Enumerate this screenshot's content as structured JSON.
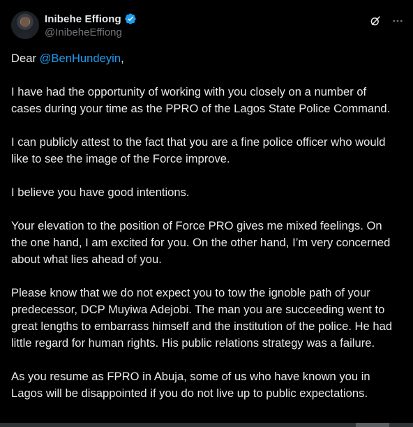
{
  "author": {
    "display_name": "Inibehe Effiong",
    "handle": "@InibeheEffiong",
    "verified_icon": "verified-badge-icon",
    "accent_color": "#1d9bf0"
  },
  "actions": {
    "grok_icon": "grok-icon",
    "more_icon": "more-icon"
  },
  "post": {
    "greeting_prefix": "Dear ",
    "greeting_mention": "@BenHundeyin",
    "greeting_suffix": ",",
    "paragraphs": [
      "I have had the opportunity of working with you closely on a number of cases during your time as the PPRO of the Lagos State Police Command.",
      "I can publicly attest to the fact that you are a fine police officer who would like to see the image of the Force improve.",
      "I believe you have good intentions.",
      "Your elevation to the position of Force PRO gives me mixed feelings. On the one hand, I am excited for you. On the other hand, I’m very concerned about what lies ahead of you.",
      "Please know that we do not expect you to tow the ignoble path of your predecessor, DCP Muyiwa Adejobi. The man you are succeeding went to great lengths to embarrass himself and the institution of the police. He had little regard for human rights. His public relations strategy was a failure.",
      "As you resume as FPRO in Abuja, some of us who have known you in Lagos will be disappointed if you do not live up to public expectations."
    ]
  },
  "colors": {
    "background": "#000000",
    "text": "#e7e9ea",
    "secondary": "#71767b",
    "link": "#1d9bf0"
  }
}
